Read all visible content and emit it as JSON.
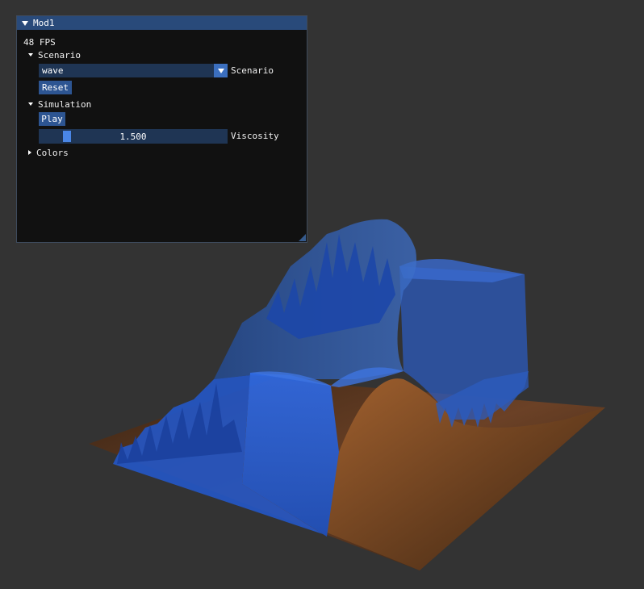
{
  "window": {
    "title": "Mod1",
    "fps_text": "48 FPS"
  },
  "scenario": {
    "header": "Scenario",
    "selected": "wave",
    "combo_label": "Scenario",
    "reset_label": "Reset"
  },
  "simulation": {
    "header": "Simulation",
    "play_label": "Play",
    "viscosity_value": "1.500",
    "viscosity_fraction": 0.125,
    "viscosity_label": "Viscosity"
  },
  "colors": {
    "header": "Colors"
  },
  "scene": {
    "background": "#333333",
    "terrain_color": "#6b4126",
    "water_color": "#2a63d6"
  }
}
